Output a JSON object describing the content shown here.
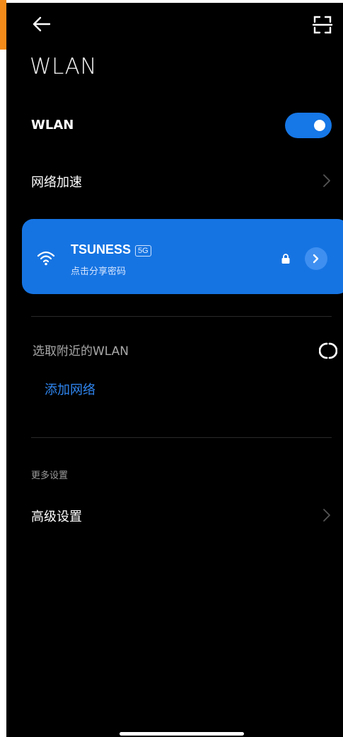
{
  "header": {
    "back_icon": "arrow-left-icon",
    "scan_icon": "scan-qr-icon",
    "title": "WLAN"
  },
  "wlan_toggle": {
    "label": "WLAN",
    "enabled": true,
    "color": "#1677e6"
  },
  "network_acceleration": {
    "label": "网络加速"
  },
  "connected_network": {
    "ssid": "TSUNESS",
    "band": "5G",
    "subtitle": "点击分享密码",
    "secured": true,
    "card_color": "#1674e2"
  },
  "nearby": {
    "title": "选取附近的WLAN",
    "add_network": "添加网络",
    "scanning_icon": "refresh-spinner-icon"
  },
  "more_settings": {
    "section_title": "更多设置",
    "advanced_label": "高级设置"
  },
  "colors": {
    "background": "#000000",
    "accent": "#2f86f0",
    "side_strip": "#f28b1a"
  }
}
